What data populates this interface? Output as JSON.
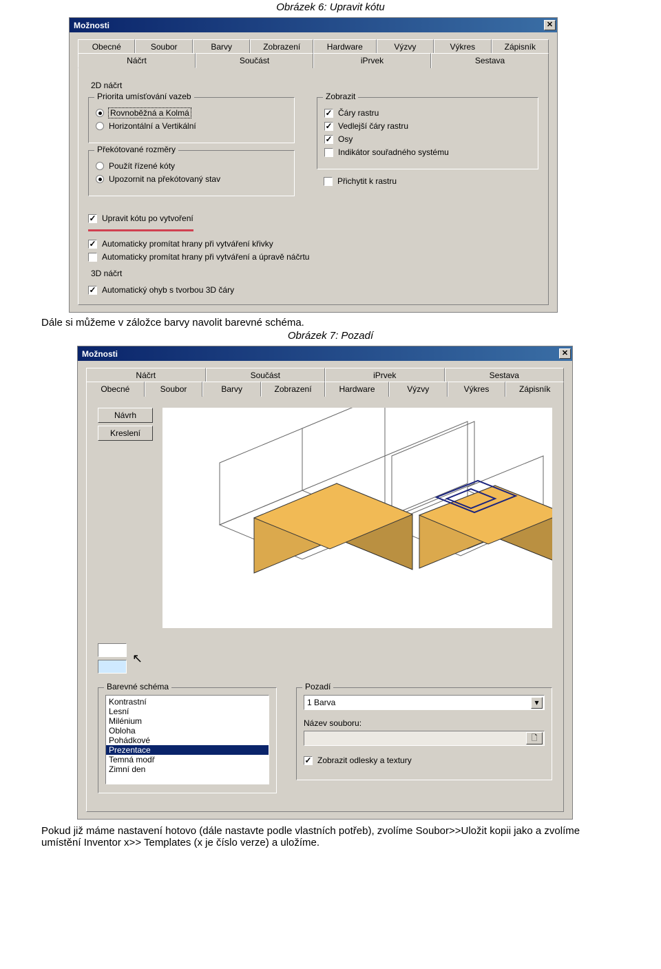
{
  "captions": {
    "fig6": "Obrázek 6: Upravit kótu",
    "fig7": "Obrázek 7: Pozadí"
  },
  "paragraphs": {
    "p1": "Dále si můžeme v záložce barvy navolit barevné schéma.",
    "p2": "Pokud již máme nastavení hotovo (dále nastavte podle vlastních potřeb), zvolíme Soubor>>Uložit kopii jako a zvolíme umístění Inventor x>> Templates (x je číslo verze) a uložíme."
  },
  "window_title": "Možnosti",
  "tabs_row1": [
    "Obecné",
    "Soubor",
    "Barvy",
    "Zobrazení",
    "Hardware",
    "Výzvy",
    "Výkres",
    "Zápisník"
  ],
  "tabs_row2": [
    "Náčrt",
    "Součást",
    "iPrvek",
    "Sestava"
  ],
  "fig6": {
    "section_2d": "2D náčrt",
    "priority_legend": "Priorita umísťování vazeb",
    "radio1": "Rovnoběžná a Kolmá",
    "radio2": "Horizontální a Vertikální",
    "over_legend": "Překótované rozměry",
    "radio3": "Použít řízené kóty",
    "radio4": "Upozornit na překótovaný stav",
    "display_legend": "Zobrazit",
    "chk_grid": "Čáry rastru",
    "chk_subgrid": "Vedlejší čáry rastru",
    "chk_axes": "Osy",
    "chk_csys": "Indikátor souřadného systému",
    "chk_snap": "Přichytit k rastru",
    "chk_edit": "Upravit kótu po vytvoření",
    "chk_proj_curve": "Automaticky promítat hrany při vytváření křivky",
    "chk_proj_edit": "Automaticky promítat hrany při vytváření a úpravě náčrtu",
    "section_3d": "3D náčrt",
    "chk_autobend": "Automatický ohyb s tvorbou 3D čáry"
  },
  "fig7": {
    "btn_design": "Návrh",
    "btn_draw": "Kreslení",
    "scheme_legend": "Barevné schéma",
    "scheme_items": [
      "Kontrastní",
      "Lesní",
      "Milénium",
      "Obloha",
      "Pohádkové",
      "Prezentace",
      "Temná modř",
      "Zimní den"
    ],
    "scheme_selected": "Prezentace",
    "bg_legend": "Pozadí",
    "bg_combo": "1 Barva",
    "filename_label": "Název souboru:",
    "chk_reflect": "Zobrazit odlesky a textury"
  }
}
